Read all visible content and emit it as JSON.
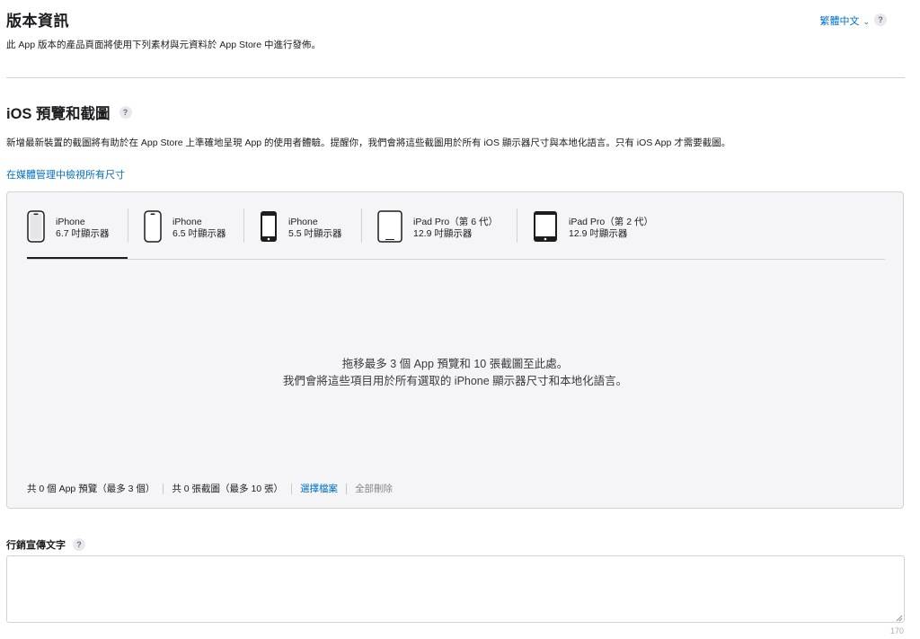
{
  "header": {
    "title": "版本資訊",
    "subtitle": "此 App 版本的產品頁面將使用下列素材與元資料於 App Store 中進行發佈。",
    "language": "繁體中文",
    "help": "?"
  },
  "ios_section": {
    "title": "iOS 預覽和截圖",
    "help": "?",
    "description": "新增最新裝置的截圖將有助於在 App Store 上準確地呈現 App 的使用者體驗。提醒你，我們會將這些截圖用於所有 iOS 顯示器尺寸與本地化語言。只有 iOS App 才需要截圖。",
    "media_link": "在媒體管理中檢視所有尺寸"
  },
  "device_tabs": [
    {
      "name": "iPhone",
      "size": "6.7 吋顯示器",
      "icon": "iphone-notch-icon",
      "active": true
    },
    {
      "name": "iPhone",
      "size": "6.5 吋顯示器",
      "icon": "iphone-notch-icon",
      "active": false
    },
    {
      "name": "iPhone",
      "size": "5.5 吋顯示器",
      "icon": "iphone-home-button-icon",
      "active": false
    },
    {
      "name": "iPad Pro（第 6 代）",
      "size": "12.9 吋顯示器",
      "icon": "ipad-pro-icon",
      "active": false
    },
    {
      "name": "iPad Pro（第 2 代）",
      "size": "12.9 吋顯示器",
      "icon": "ipad-home-button-icon",
      "active": false
    }
  ],
  "dropzone": {
    "line1": "拖移最多 3 個 App 預覽和 10 張截圖至此處。",
    "line2": "我們會將這些項目用於所有選取的 iPhone 顯示器尺寸和本地化語言。"
  },
  "footer": {
    "previews": "共 0 個 App 預覽（最多 3 個）",
    "screenshots": "共 0 張截圖（最多 10 張）",
    "choose_file": "選擇檔案",
    "delete_all": "全部刪除"
  },
  "promo": {
    "label": "行銷宣傳文字",
    "help": "?",
    "value": "",
    "remaining": "170"
  },
  "colors": {
    "link": "#0070c9",
    "panel": "#f5f5f7",
    "border": "#d2d2d7"
  }
}
